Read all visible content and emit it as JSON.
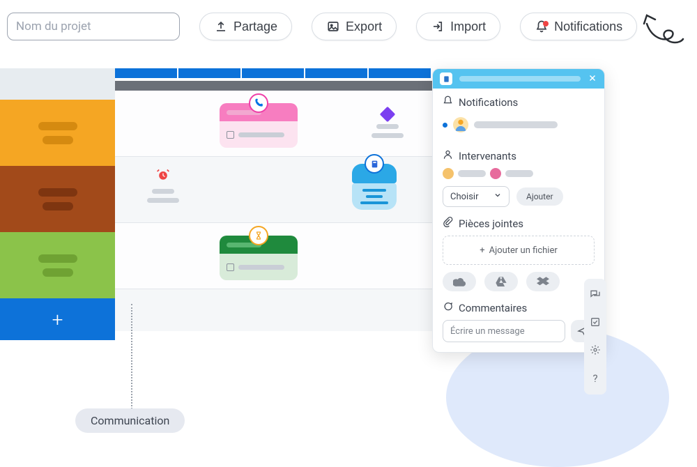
{
  "toolbar": {
    "project_name_placeholder": "Nom du projet",
    "partage": "Partage",
    "export": "Export",
    "import": "Import",
    "notifications": "Notifications"
  },
  "panel": {
    "notifications_title": "Notifications",
    "intervenants_title": "Intervenants",
    "choisir": "Choisir",
    "ajouter": "Ajouter",
    "pieces_jointes_title": "Pièces jointes",
    "ajouter_fichier": "Ajouter un fichier",
    "commentaires_title": "Commentaires",
    "ecrire_placeholder": "Écrire un message"
  },
  "label": {
    "communication": "Communication"
  },
  "colors": {
    "primary_blue": "#0d72d9",
    "orange": "#f5a623",
    "brown": "#a24a1a",
    "green": "#8bc34a",
    "pink": "#f77dc0",
    "cyan_header": "#55c3f0"
  }
}
